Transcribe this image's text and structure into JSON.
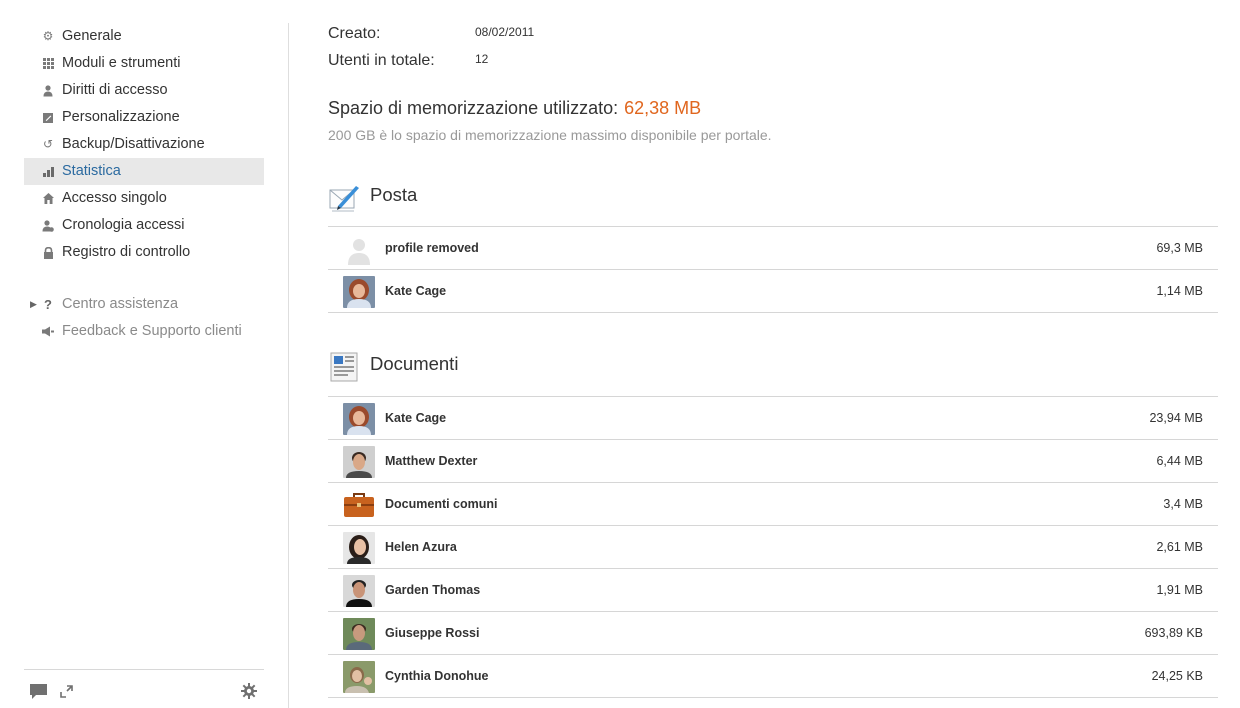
{
  "sidebar": {
    "items": [
      {
        "label": "Generale",
        "icon": "gear-icon",
        "glyph": "⚙"
      },
      {
        "label": "Moduli e strumenti",
        "icon": "grid-icon",
        "glyph": "▦"
      },
      {
        "label": "Diritti di accesso",
        "icon": "user-key-icon",
        "glyph": "♟"
      },
      {
        "label": "Personalizzazione",
        "icon": "edit-icon",
        "glyph": "◩"
      },
      {
        "label": "Backup/Disattivazione",
        "icon": "restore-icon",
        "glyph": "↺"
      },
      {
        "label": "Statistica",
        "icon": "bar-chart-icon",
        "glyph": "▮",
        "active": true
      },
      {
        "label": "Accesso singolo",
        "icon": "home-icon",
        "glyph": "⌂"
      },
      {
        "label": "Cronologia accessi",
        "icon": "user-history-icon",
        "glyph": "♟"
      },
      {
        "label": "Registro di controllo",
        "icon": "lock-icon",
        "glyph": "🔒"
      }
    ],
    "help_items": [
      {
        "label": "Centro assistenza",
        "icon": "question-icon",
        "glyph": "?"
      },
      {
        "label": "Feedback e Supporto clienti",
        "icon": "megaphone-icon",
        "glyph": "📢"
      }
    ]
  },
  "info": {
    "created_label": "Creato:",
    "created_value": "08/02/2011",
    "users_label": "Utenti in totale:",
    "users_value": "12"
  },
  "storage": {
    "label": "Spazio di memorizzazione utilizzato:",
    "used": "62,38 MB",
    "note": "200 GB è lo spazio di memorizzazione massimo disponibile per portale."
  },
  "mail": {
    "title": "Posta",
    "rows": [
      {
        "name": "profile removed",
        "size": "69,3 MB",
        "avatar": "default"
      },
      {
        "name": "Kate Cage",
        "size": "1,14 MB",
        "avatar": "kate"
      }
    ]
  },
  "documents": {
    "title": "Documenti",
    "rows": [
      {
        "name": "Kate Cage",
        "size": "23,94 MB",
        "avatar": "kate"
      },
      {
        "name": "Matthew Dexter",
        "size": "6,44 MB",
        "avatar": "matthew"
      },
      {
        "name": "Documenti comuni",
        "size": "3,4 MB",
        "avatar": "briefcase"
      },
      {
        "name": "Helen Azura",
        "size": "2,61 MB",
        "avatar": "helen"
      },
      {
        "name": "Garden Thomas",
        "size": "1,91 MB",
        "avatar": "garden"
      },
      {
        "name": "Giuseppe Rossi",
        "size": "693,89 KB",
        "avatar": "giuseppe"
      },
      {
        "name": "Cynthia Donohue",
        "size": "24,25 KB",
        "avatar": "cynthia"
      }
    ]
  },
  "colors": {
    "accent_used": "#e0661e",
    "active_text": "#2b6aa0",
    "active_bg": "#e8e8e8"
  }
}
